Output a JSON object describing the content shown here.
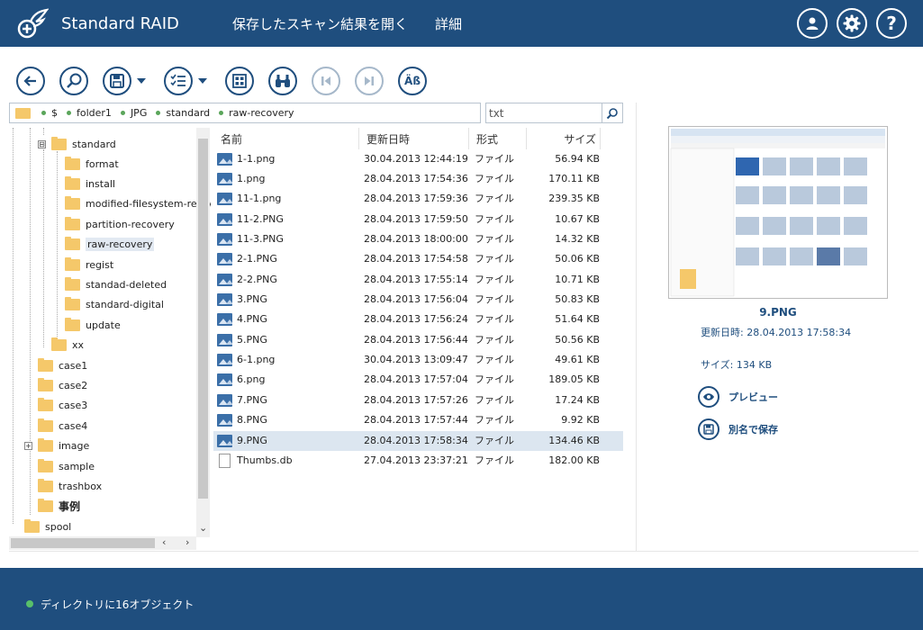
{
  "app": {
    "title": "Standard RAID"
  },
  "menu": {
    "open_scan": "保存したスキャン結果を開く",
    "details": "詳細"
  },
  "toolbar": {
    "charset_label": "Äß"
  },
  "breadcrumb": {
    "items": [
      "$",
      "folder1",
      "JPG",
      "standard",
      "raw-recovery"
    ]
  },
  "search": {
    "value": "txt"
  },
  "tree": {
    "nodes": [
      {
        "label": "standard",
        "expander": "⊟"
      },
      {
        "label": "format"
      },
      {
        "label": "install"
      },
      {
        "label": "modified-filesystem-recov"
      },
      {
        "label": "partition-recovery"
      },
      {
        "label": "raw-recovery"
      },
      {
        "label": "regist"
      },
      {
        "label": "standad-deleted"
      },
      {
        "label": "standard-digital"
      },
      {
        "label": "update"
      },
      {
        "label": "xx"
      },
      {
        "label": "case1"
      },
      {
        "label": "case2"
      },
      {
        "label": "case3"
      },
      {
        "label": "case4"
      },
      {
        "label": "image",
        "expander": "+"
      },
      {
        "label": "sample"
      },
      {
        "label": "trashbox"
      },
      {
        "label": "事例"
      },
      {
        "label": "spool"
      }
    ]
  },
  "files": {
    "columns": {
      "name": "名前",
      "date": "更新日時",
      "type": "形式",
      "size": "サイズ"
    },
    "rows": [
      {
        "name": "1-1.png",
        "date": "30.04.2013 12:44:19",
        "type": "ファイル",
        "size": "56.94 KB"
      },
      {
        "name": "1.png",
        "date": "28.04.2013 17:54:36",
        "type": "ファイル",
        "size": "170.11 KB"
      },
      {
        "name": "11-1.png",
        "date": "28.04.2013 17:59:36",
        "type": "ファイル",
        "size": "239.35 KB"
      },
      {
        "name": "11-2.PNG",
        "date": "28.04.2013 17:59:50",
        "type": "ファイル",
        "size": "10.67 KB"
      },
      {
        "name": "11-3.PNG",
        "date": "28.04.2013 18:00:00",
        "type": "ファイル",
        "size": "14.32 KB"
      },
      {
        "name": "2-1.PNG",
        "date": "28.04.2013 17:54:58",
        "type": "ファイル",
        "size": "50.06 KB"
      },
      {
        "name": "2-2.PNG",
        "date": "28.04.2013 17:55:14",
        "type": "ファイル",
        "size": "10.71 KB"
      },
      {
        "name": "3.PNG",
        "date": "28.04.2013 17:56:04",
        "type": "ファイル",
        "size": "50.83 KB"
      },
      {
        "name": "4.PNG",
        "date": "28.04.2013 17:56:24",
        "type": "ファイル",
        "size": "51.64 KB"
      },
      {
        "name": "5.PNG",
        "date": "28.04.2013 17:56:44",
        "type": "ファイル",
        "size": "50.56 KB"
      },
      {
        "name": "6-1.png",
        "date": "30.04.2013 13:09:47",
        "type": "ファイル",
        "size": "49.61 KB"
      },
      {
        "name": "6.png",
        "date": "28.04.2013 17:57:04",
        "type": "ファイル",
        "size": "189.05 KB"
      },
      {
        "name": "7.PNG",
        "date": "28.04.2013 17:57:26",
        "type": "ファイル",
        "size": "17.24 KB"
      },
      {
        "name": "8.PNG",
        "date": "28.04.2013 17:57:44",
        "type": "ファイル",
        "size": "9.92 KB"
      },
      {
        "name": "9.PNG",
        "date": "28.04.2013 17:58:34",
        "type": "ファイル",
        "size": "134.46 KB"
      },
      {
        "name": "Thumbs.db",
        "date": "27.04.2013 23:37:21",
        "type": "ファイル",
        "size": "182.00 KB"
      }
    ]
  },
  "preview": {
    "name": "9.PNG",
    "modified": "更新日時: 28.04.2013 17:58:34",
    "size": "サイズ: 134 KB",
    "preview_action": "プレビュー",
    "save_as_action": "別名で保存"
  },
  "status": {
    "text": "ディレクトリに16オブジェクト"
  },
  "colors": {
    "brand": "#1f4e7e",
    "folder": "#f5c86a",
    "selection": "#dce6f0",
    "status_dot": "#58c06a"
  }
}
